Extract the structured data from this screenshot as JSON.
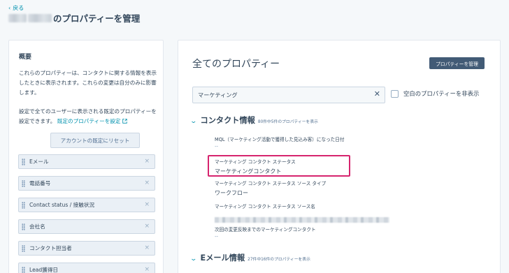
{
  "header": {
    "back_label": "戻る",
    "title_suffix": "のプロパティーを管理"
  },
  "overview": {
    "heading": "概要",
    "description": "これらのプロパティーは、コンタクトに関する情報を表示したときに表示されます。これらの変更は自分のみに影響します。",
    "defaults_text": "設定で全てのユーザーに表示される既定のプロパティーを設定できます。",
    "defaults_link": "既定のプロパティーを設定",
    "reset_button": "アカウントの既定にリセット",
    "properties": [
      {
        "label": "Eメール"
      },
      {
        "label": "電話番号"
      },
      {
        "label": "Contact status / 接触状況"
      },
      {
        "label": "会社名"
      },
      {
        "label": "コンタクト担当者"
      },
      {
        "label": "Lead獲得日"
      }
    ]
  },
  "main": {
    "title": "全てのプロパティー",
    "manage_button": "プロパティーを管理",
    "search_value": "マーケティング",
    "hide_empty_label": "空白のプロパティーを非表示",
    "sections": [
      {
        "title": "コンタクト情報",
        "count": "80件中5件のプロパティーを表示",
        "properties": [
          {
            "label": "MQL（マーケティング活動で獲得した見込み客）になった日付",
            "value": "--"
          },
          {
            "label": "マーケティング コンタクト ステータス",
            "value": "マーケティングコンタクト"
          },
          {
            "label": "マーケティング コンタクト ステータス ソース タイプ",
            "value": "ワークフロー"
          },
          {
            "label": "マーケティング コンタクト ステータス ソース名",
            "value": ""
          },
          {
            "label": "次回の変更反映までのマーケティングコンタクト",
            "value": "--"
          }
        ]
      },
      {
        "title": "Eメール情報",
        "count": "27件中16件のプロパティーを表示"
      }
    ]
  },
  "colors": {
    "accent": "#0091ae",
    "button_dark": "#425b76",
    "highlight": "#d6246e",
    "background": "#f5f8fa"
  }
}
